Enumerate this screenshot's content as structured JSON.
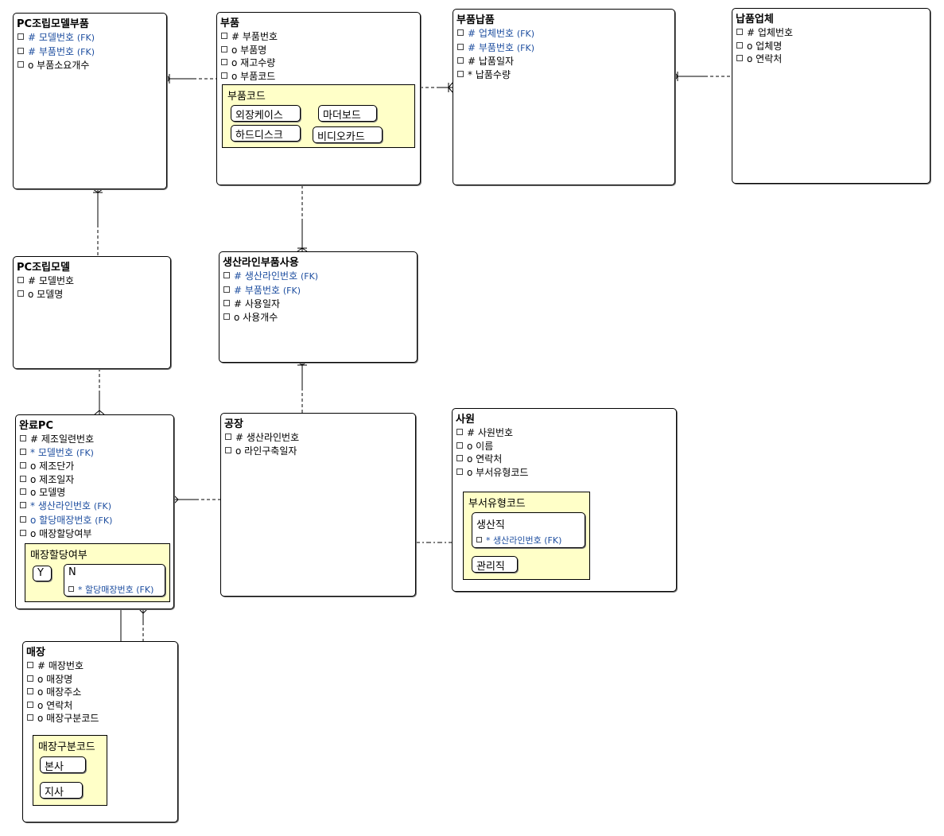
{
  "entities": {
    "pc_model_part": {
      "title": "PC조립모델부품",
      "attrs": [
        {
          "mark": "#",
          "name": "모델번호",
          "fk": "(FK)"
        },
        {
          "mark": "#",
          "name": "부품번호",
          "fk": "(FK)"
        },
        {
          "mark": "o",
          "name": "부품소요개수",
          "fk": ""
        }
      ]
    },
    "part": {
      "title": "부품",
      "attrs": [
        {
          "mark": "#",
          "name": "부품번호",
          "fk": ""
        },
        {
          "mark": "o",
          "name": "부품명",
          "fk": ""
        },
        {
          "mark": "o",
          "name": "재고수량",
          "fk": ""
        },
        {
          "mark": "o",
          "name": "부품코드",
          "fk": ""
        }
      ],
      "subtype_title": "부품코드",
      "subtypes": [
        "외장케이스",
        "마더보드",
        "하드디스크",
        "비디오카드"
      ]
    },
    "part_supply": {
      "title": "부품납품",
      "attrs": [
        {
          "mark": "#",
          "name": "업체번호",
          "fk": "(FK)"
        },
        {
          "mark": "#",
          "name": "부품번호",
          "fk": "(FK)"
        },
        {
          "mark": "#",
          "name": "납품일자",
          "fk": ""
        },
        {
          "mark": "*",
          "name": "납품수량",
          "fk": ""
        }
      ]
    },
    "supplier": {
      "title": "납품업체",
      "attrs": [
        {
          "mark": "#",
          "name": "업체번호",
          "fk": ""
        },
        {
          "mark": "o",
          "name": "업체명",
          "fk": ""
        },
        {
          "mark": "o",
          "name": "연락처",
          "fk": ""
        }
      ]
    },
    "pc_model": {
      "title": "PC조립모델",
      "attrs": [
        {
          "mark": "#",
          "name": "모델번호",
          "fk": ""
        },
        {
          "mark": "o",
          "name": "모델명",
          "fk": ""
        }
      ]
    },
    "line_part_use": {
      "title": "생산라인부품사용",
      "attrs": [
        {
          "mark": "#",
          "name": "생산라인번호",
          "fk": "(FK)"
        },
        {
          "mark": "#",
          "name": "부품번호",
          "fk": "(FK)"
        },
        {
          "mark": "#",
          "name": "사용일자",
          "fk": ""
        },
        {
          "mark": "o",
          "name": "사용개수",
          "fk": ""
        }
      ]
    },
    "finished_pc": {
      "title": "완료PC",
      "attrs": [
        {
          "mark": "#",
          "name": "제조일련번호",
          "fk": ""
        },
        {
          "mark": "*",
          "name": "모델번호",
          "fk": "(FK)"
        },
        {
          "mark": "o",
          "name": "제조단가",
          "fk": ""
        },
        {
          "mark": "o",
          "name": "제조일자",
          "fk": ""
        },
        {
          "mark": "o",
          "name": "모델명",
          "fk": ""
        },
        {
          "mark": "*",
          "name": "생산라인번호",
          "fk": "(FK)"
        },
        {
          "mark": "o",
          "name": "할당매장번호",
          "fk": "(FK)"
        },
        {
          "mark": "o",
          "name": "매장할당여부",
          "fk": ""
        }
      ],
      "subtype_title": "매장할당여부",
      "sub_y": "Y",
      "sub_n": "N",
      "sub_n_attr": {
        "mark": "*",
        "name": "할당매장번호",
        "fk": "(FK)"
      }
    },
    "factory": {
      "title": "공장",
      "attrs": [
        {
          "mark": "#",
          "name": "생산라인번호",
          "fk": ""
        },
        {
          "mark": "o",
          "name": "라인구축일자",
          "fk": ""
        }
      ]
    },
    "employee": {
      "title": "사원",
      "attrs": [
        {
          "mark": "#",
          "name": "사원번호",
          "fk": ""
        },
        {
          "mark": "o",
          "name": "이름",
          "fk": ""
        },
        {
          "mark": "o",
          "name": "연락처",
          "fk": ""
        },
        {
          "mark": "o",
          "name": "부서유형코드",
          "fk": ""
        }
      ],
      "subtype_title": "부서유형코드",
      "sub_prod": "생산직",
      "sub_prod_attr": {
        "mark": "*",
        "name": "생산라인번호",
        "fk": "(FK)"
      },
      "sub_mgmt": "관리직"
    },
    "store": {
      "title": "매장",
      "attrs": [
        {
          "mark": "#",
          "name": "매장번호",
          "fk": ""
        },
        {
          "mark": "o",
          "name": "매장명",
          "fk": ""
        },
        {
          "mark": "o",
          "name": "매장주소",
          "fk": ""
        },
        {
          "mark": "o",
          "name": "연락처",
          "fk": ""
        },
        {
          "mark": "o",
          "name": "매장구분코드",
          "fk": ""
        }
      ],
      "subtype_title": "매장구분코드",
      "subtypes": [
        "본사",
        "지사"
      ]
    }
  },
  "colors": {
    "fk_text": "#1f4fa0",
    "subtype_fill": "#ffffc8",
    "line": "#000000"
  }
}
